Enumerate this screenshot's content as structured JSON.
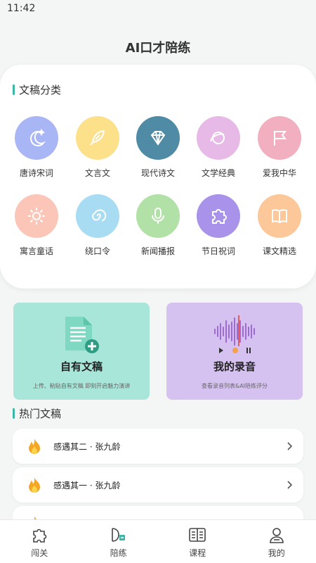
{
  "status_bar": {
    "time": "11:42"
  },
  "app": {
    "title": "AI口才陪练"
  },
  "categories_section": {
    "title": "文稿分类",
    "items": [
      {
        "label": "唐诗宋词",
        "icon": "moon-star-icon",
        "color": "#a9b6f5"
      },
      {
        "label": "文言文",
        "icon": "feather-icon",
        "color": "#fde08a"
      },
      {
        "label": "现代诗文",
        "icon": "diamond-icon",
        "color": "#4f8ba5"
      },
      {
        "label": "文学经典",
        "icon": "planet-ring-icon",
        "color": "#e7b9e7"
      },
      {
        "label": "爱我中华",
        "icon": "flag-icon",
        "color": "#f1afc0"
      },
      {
        "label": "寓言童话",
        "icon": "sun-icon",
        "color": "#fbc6b8"
      },
      {
        "label": "绕口令",
        "icon": "swirl-icon",
        "color": "#a7dcf2"
      },
      {
        "label": "新闻播报",
        "icon": "microphone-icon",
        "color": "#b1e1a6"
      },
      {
        "label": "节日祝词",
        "icon": "puzzle-icon",
        "color": "#a993ea"
      },
      {
        "label": "课文精选",
        "icon": "book-icon",
        "color": "#fcc799"
      }
    ]
  },
  "features": {
    "own_script": {
      "title": "自有文稿",
      "subtitle": "上传、粘贴自有文稿 即刻开启魅力演讲"
    },
    "my_recordings": {
      "title": "我的录音",
      "subtitle": "查看录音列表&AI陪练评分"
    }
  },
  "hot_section": {
    "title": "热门文稿",
    "items": [
      {
        "title": "感遇其二 · 张九龄"
      },
      {
        "title": "感遇其一 · 张九龄"
      }
    ]
  },
  "tabbar": {
    "tabs": [
      {
        "label": "闯关",
        "icon": "puzzle-piece-icon"
      },
      {
        "label": "陪练",
        "icon": "practice-icon"
      },
      {
        "label": "课程",
        "icon": "open-book-icon"
      },
      {
        "label": "我的",
        "icon": "user-icon"
      }
    ]
  },
  "colors": {
    "accent": "#3cb6a6",
    "flame": "#f5a623"
  }
}
